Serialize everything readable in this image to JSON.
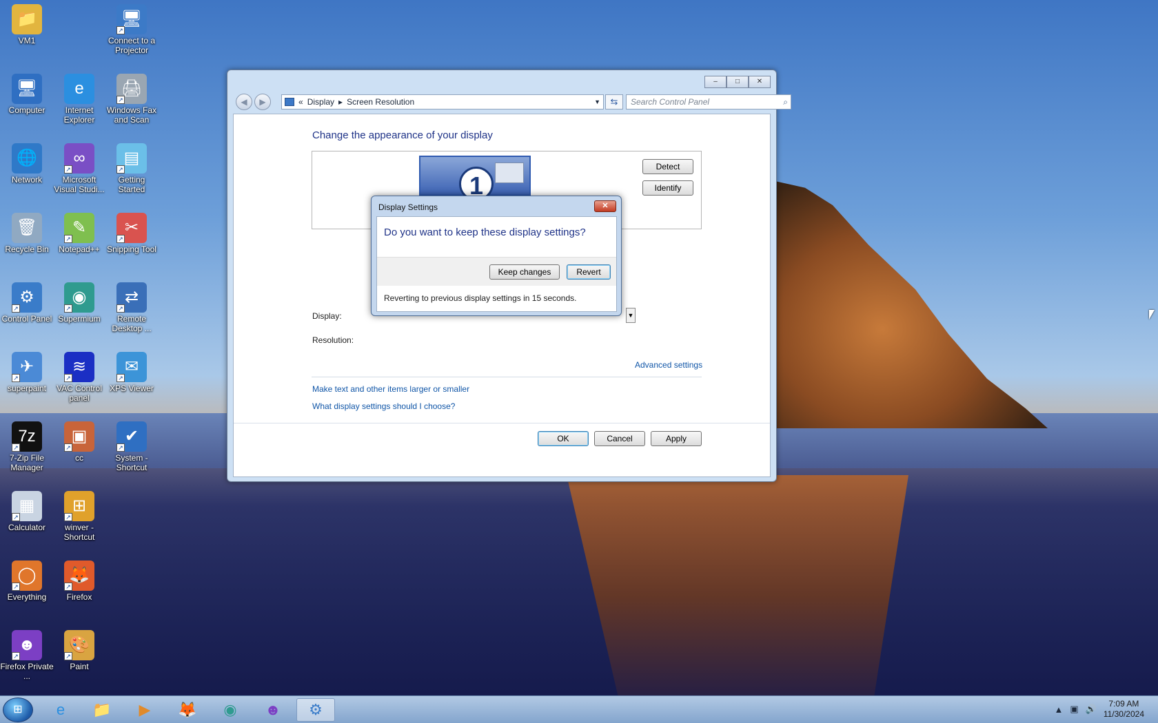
{
  "desktop": {
    "icons": [
      {
        "label": "VM1",
        "glyph": "📁",
        "color": "#e2b53f"
      },
      {
        "label": "Connect to a Projector",
        "glyph": "🖥",
        "color": "#3c7ac7"
      },
      {
        "label": "Computer",
        "glyph": "🖥",
        "color": "#2f6fc2"
      },
      {
        "label": "Internet Explorer",
        "glyph": "e",
        "color": "#2b8fe0"
      },
      {
        "label": "Windows Fax and Scan",
        "glyph": "🖨",
        "color": "#9aa6b2"
      },
      {
        "label": "Network",
        "glyph": "🌐",
        "color": "#2f79c8"
      },
      {
        "label": "Microsoft Visual Studi...",
        "glyph": "∞",
        "color": "#7a4fc5"
      },
      {
        "label": "Getting Started",
        "glyph": "▤",
        "color": "#6bbfe8"
      },
      {
        "label": "Recycle Bin",
        "glyph": "🗑",
        "color": "#90a9c2"
      },
      {
        "label": "Notepad++",
        "glyph": "✎",
        "color": "#7fbf4f"
      },
      {
        "label": "Snipping Tool",
        "glyph": "✂",
        "color": "#d9534f"
      },
      {
        "label": "Control Panel",
        "glyph": "⚙",
        "color": "#3a7cc9"
      },
      {
        "label": "Supermium",
        "glyph": "◉",
        "color": "#2f9b8f"
      },
      {
        "label": "Remote Desktop ...",
        "glyph": "⇄",
        "color": "#3a6fb8"
      },
      {
        "label": "superpaint",
        "glyph": "✈",
        "color": "#4b8ad6"
      },
      {
        "label": "VAC Control panel",
        "glyph": "≋",
        "color": "#1b2fc4"
      },
      {
        "label": "XPS Viewer",
        "glyph": "✉",
        "color": "#3c94d8"
      },
      {
        "label": "7-Zip File Manager",
        "glyph": "7z",
        "color": "#111111"
      },
      {
        "label": "cc",
        "glyph": "▣",
        "color": "#c8643a"
      },
      {
        "label": "System - Shortcut",
        "glyph": "✔",
        "color": "#2f6fc2"
      },
      {
        "label": "Calculator",
        "glyph": "▦",
        "color": "#c9d4e2"
      },
      {
        "label": "winver - Shortcut",
        "glyph": "⊞",
        "color": "#e0a12b"
      },
      {
        "label": "Everything",
        "glyph": "◯",
        "color": "#e0762b"
      },
      {
        "label": "Firefox",
        "glyph": "🦊",
        "color": "#e05a2b"
      },
      {
        "label": "Firefox Private ...",
        "glyph": "☻",
        "color": "#7c3fc4"
      },
      {
        "label": "Paint",
        "glyph": "🎨",
        "color": "#d9a441"
      }
    ]
  },
  "window": {
    "breadcrumb_prefix": "«",
    "breadcrumb": [
      "Display",
      "Screen Resolution"
    ],
    "search_placeholder": "Search Control Panel",
    "caption": {
      "minimize": "–",
      "maximize": "□",
      "close": "✕"
    }
  },
  "screen_resolution": {
    "heading": "Change the appearance of your display",
    "monitor_number": "1",
    "detect_label": "Detect",
    "identify_label": "Identify",
    "display_label": "Display:",
    "resolution_label": "Resolution:",
    "advanced_link": "Advanced settings",
    "link_text_size": "Make text and other items larger or smaller",
    "link_help": "What display settings should I choose?",
    "ok_label": "OK",
    "cancel_label": "Cancel",
    "apply_label": "Apply"
  },
  "dialog": {
    "title": "Display Settings",
    "question": "Do you want to keep these display settings?",
    "keep_label": "Keep changes",
    "revert_label": "Revert",
    "countdown": "Reverting to previous display settings in 15 seconds."
  },
  "taskbar": {
    "items": [
      {
        "name": "internet-explorer",
        "glyph": "e",
        "color": "#2b8fe0"
      },
      {
        "name": "file-explorer",
        "glyph": "📁",
        "color": "#d9a441"
      },
      {
        "name": "media-player",
        "glyph": "▶",
        "color": "#e08a2b"
      },
      {
        "name": "firefox",
        "glyph": "🦊",
        "color": "#e05a2b"
      },
      {
        "name": "supermium",
        "glyph": "◉",
        "color": "#2f9b8f"
      },
      {
        "name": "firefox-private",
        "glyph": "☻",
        "color": "#7c3fc4"
      },
      {
        "name": "control-panel",
        "glyph": "⚙",
        "color": "#3a7cc9"
      }
    ],
    "clock_time": "7:09 AM",
    "clock_date": "11/30/2024"
  }
}
